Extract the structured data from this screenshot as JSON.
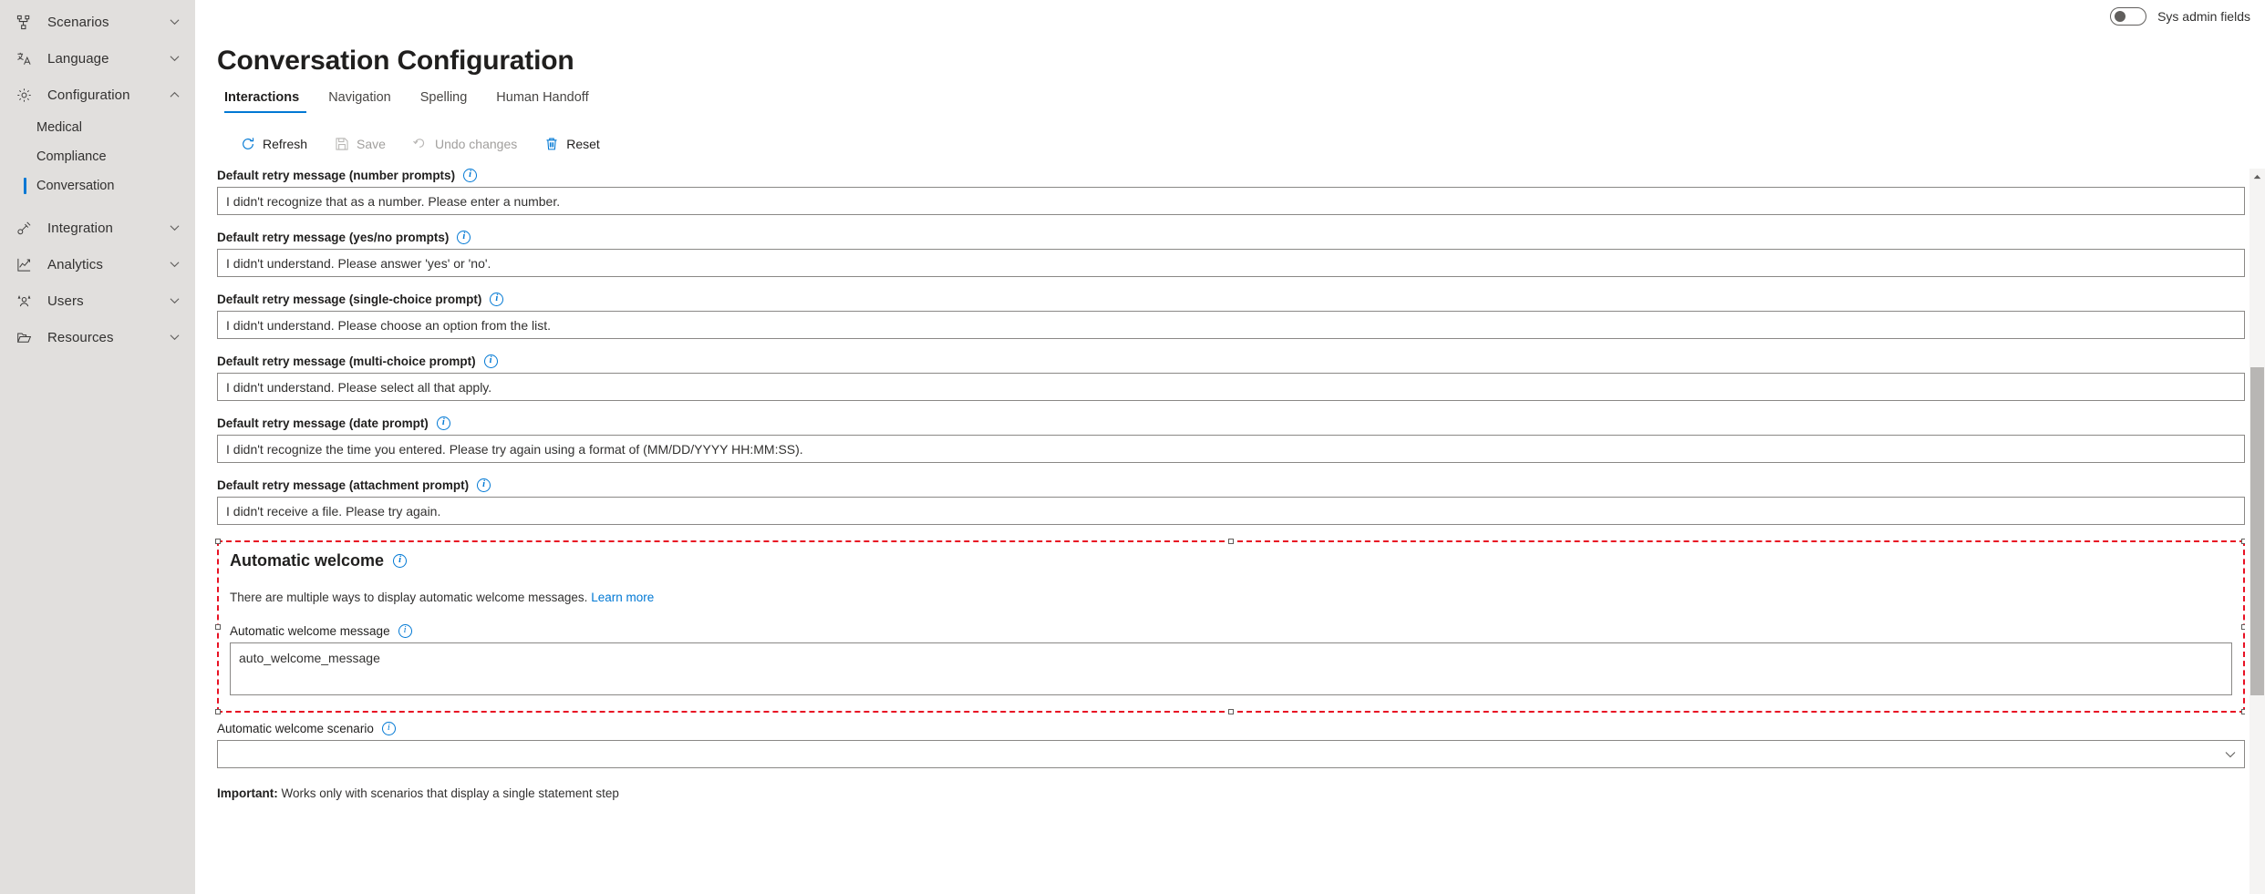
{
  "sidebar": {
    "groups": [
      {
        "label": "Scenarios",
        "icon": "scenarios-icon",
        "expanded": false,
        "chevron": "chevron-down"
      },
      {
        "label": "Language",
        "icon": "language-icon",
        "expanded": false,
        "chevron": "chevron-down"
      },
      {
        "label": "Configuration",
        "icon": "gear-icon",
        "expanded": true,
        "chevron": "chevron-up"
      },
      {
        "label": "Integration",
        "icon": "plug-icon",
        "expanded": false,
        "chevron": "chevron-down"
      },
      {
        "label": "Analytics",
        "icon": "analytics-icon",
        "expanded": false,
        "chevron": "chevron-down"
      },
      {
        "label": "Users",
        "icon": "users-icon",
        "expanded": false,
        "chevron": "chevron-down"
      },
      {
        "label": "Resources",
        "icon": "folder-icon",
        "expanded": false,
        "chevron": "chevron-down"
      }
    ],
    "children": [
      {
        "label": "Medical",
        "selected": false
      },
      {
        "label": "Compliance",
        "selected": false
      },
      {
        "label": "Conversation",
        "selected": true
      }
    ]
  },
  "topbar": {
    "sys_admin_label": "Sys admin fields",
    "sys_admin_on": false
  },
  "header": {
    "title": "Conversation Configuration"
  },
  "tabs": [
    {
      "label": "Interactions",
      "active": true
    },
    {
      "label": "Navigation",
      "active": false
    },
    {
      "label": "Spelling",
      "active": false
    },
    {
      "label": "Human Handoff",
      "active": false
    }
  ],
  "toolbar": {
    "refresh_label": "Refresh",
    "save_label": "Save",
    "undo_label": "Undo changes",
    "reset_label": "Reset",
    "save_disabled": true,
    "undo_disabled": true
  },
  "fields": [
    {
      "label": "Default retry message (number prompts)",
      "value": "I didn't recognize that as a number. Please enter a number."
    },
    {
      "label": "Default retry message (yes/no prompts)",
      "value": "I didn't understand. Please answer 'yes' or 'no'."
    },
    {
      "label": "Default retry message (single-choice prompt)",
      "value": "I didn't understand. Please choose an option from the list."
    },
    {
      "label": "Default retry message (multi-choice prompt)",
      "value": "I didn't understand. Please select all that apply."
    },
    {
      "label": "Default retry message (date prompt)",
      "value": "I didn't recognize the time you entered. Please try again using a format of (MM/DD/YYYY HH:MM:SS)."
    },
    {
      "label": "Default retry message (attachment prompt)",
      "value": "I didn't receive a file. Please try again."
    }
  ],
  "automatic_welcome": {
    "section_title": "Automatic welcome",
    "description": "There are multiple ways to display automatic welcome messages.",
    "learn_more": "Learn more",
    "message_label": "Automatic welcome message",
    "message_value": "auto_welcome_message",
    "selection_color": "#e81123"
  },
  "welcome_scenario": {
    "label": "Automatic welcome scenario",
    "value": "",
    "placeholder": ""
  },
  "important_note": {
    "prefix": "Important:",
    "text": " Works only with scenarios that display a single statement step"
  },
  "colors": {
    "accent": "#0078d4",
    "sidebar_bg": "#e1dfdd",
    "selection": "#e81123"
  },
  "icons": {
    "info": "i",
    "chevron_down": "chevron-down-icon",
    "chevron_up": "chevron-up-icon"
  }
}
